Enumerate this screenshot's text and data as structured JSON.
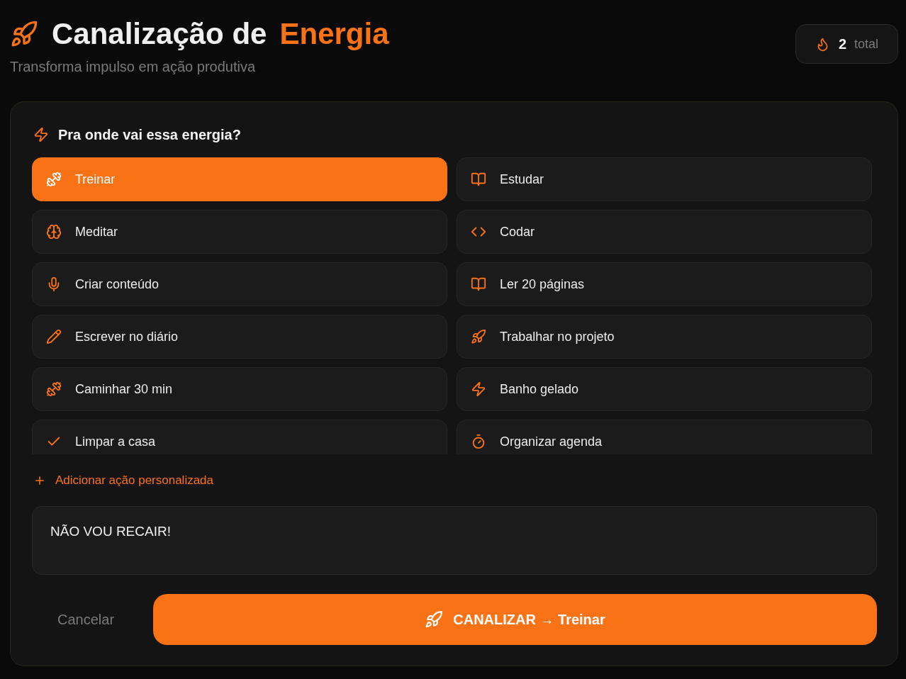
{
  "header": {
    "title": "Canalização de",
    "title_accent": "Energia",
    "subtitle": "Transforma impulso em ação produtiva"
  },
  "counter": {
    "value": "2",
    "label": "total"
  },
  "panel": {
    "heading": "Pra onde vai essa energia?",
    "actions": [
      {
        "label": "Treinar",
        "selected": true
      },
      {
        "label": "Estudar",
        "selected": false
      },
      {
        "label": "Meditar",
        "selected": false
      },
      {
        "label": "Codar",
        "selected": false
      },
      {
        "label": "Criar conteúdo",
        "selected": false
      },
      {
        "label": "Ler 20 páginas",
        "selected": false
      },
      {
        "label": "Escrever no diário",
        "selected": false
      },
      {
        "label": "Trabalhar no projeto",
        "selected": false
      },
      {
        "label": "Caminhar 30 min",
        "selected": false
      },
      {
        "label": "Banho gelado",
        "selected": false
      },
      {
        "label": "Limpar a casa",
        "selected": false
      },
      {
        "label": "Organizar agenda",
        "selected": false
      }
    ],
    "add_link": "Adicionar ação personalizada",
    "note": {
      "value": "NÃO VOU RECAIR!"
    },
    "cancel": "Cancelar",
    "submit": "CANALIZAR → Treinar"
  }
}
